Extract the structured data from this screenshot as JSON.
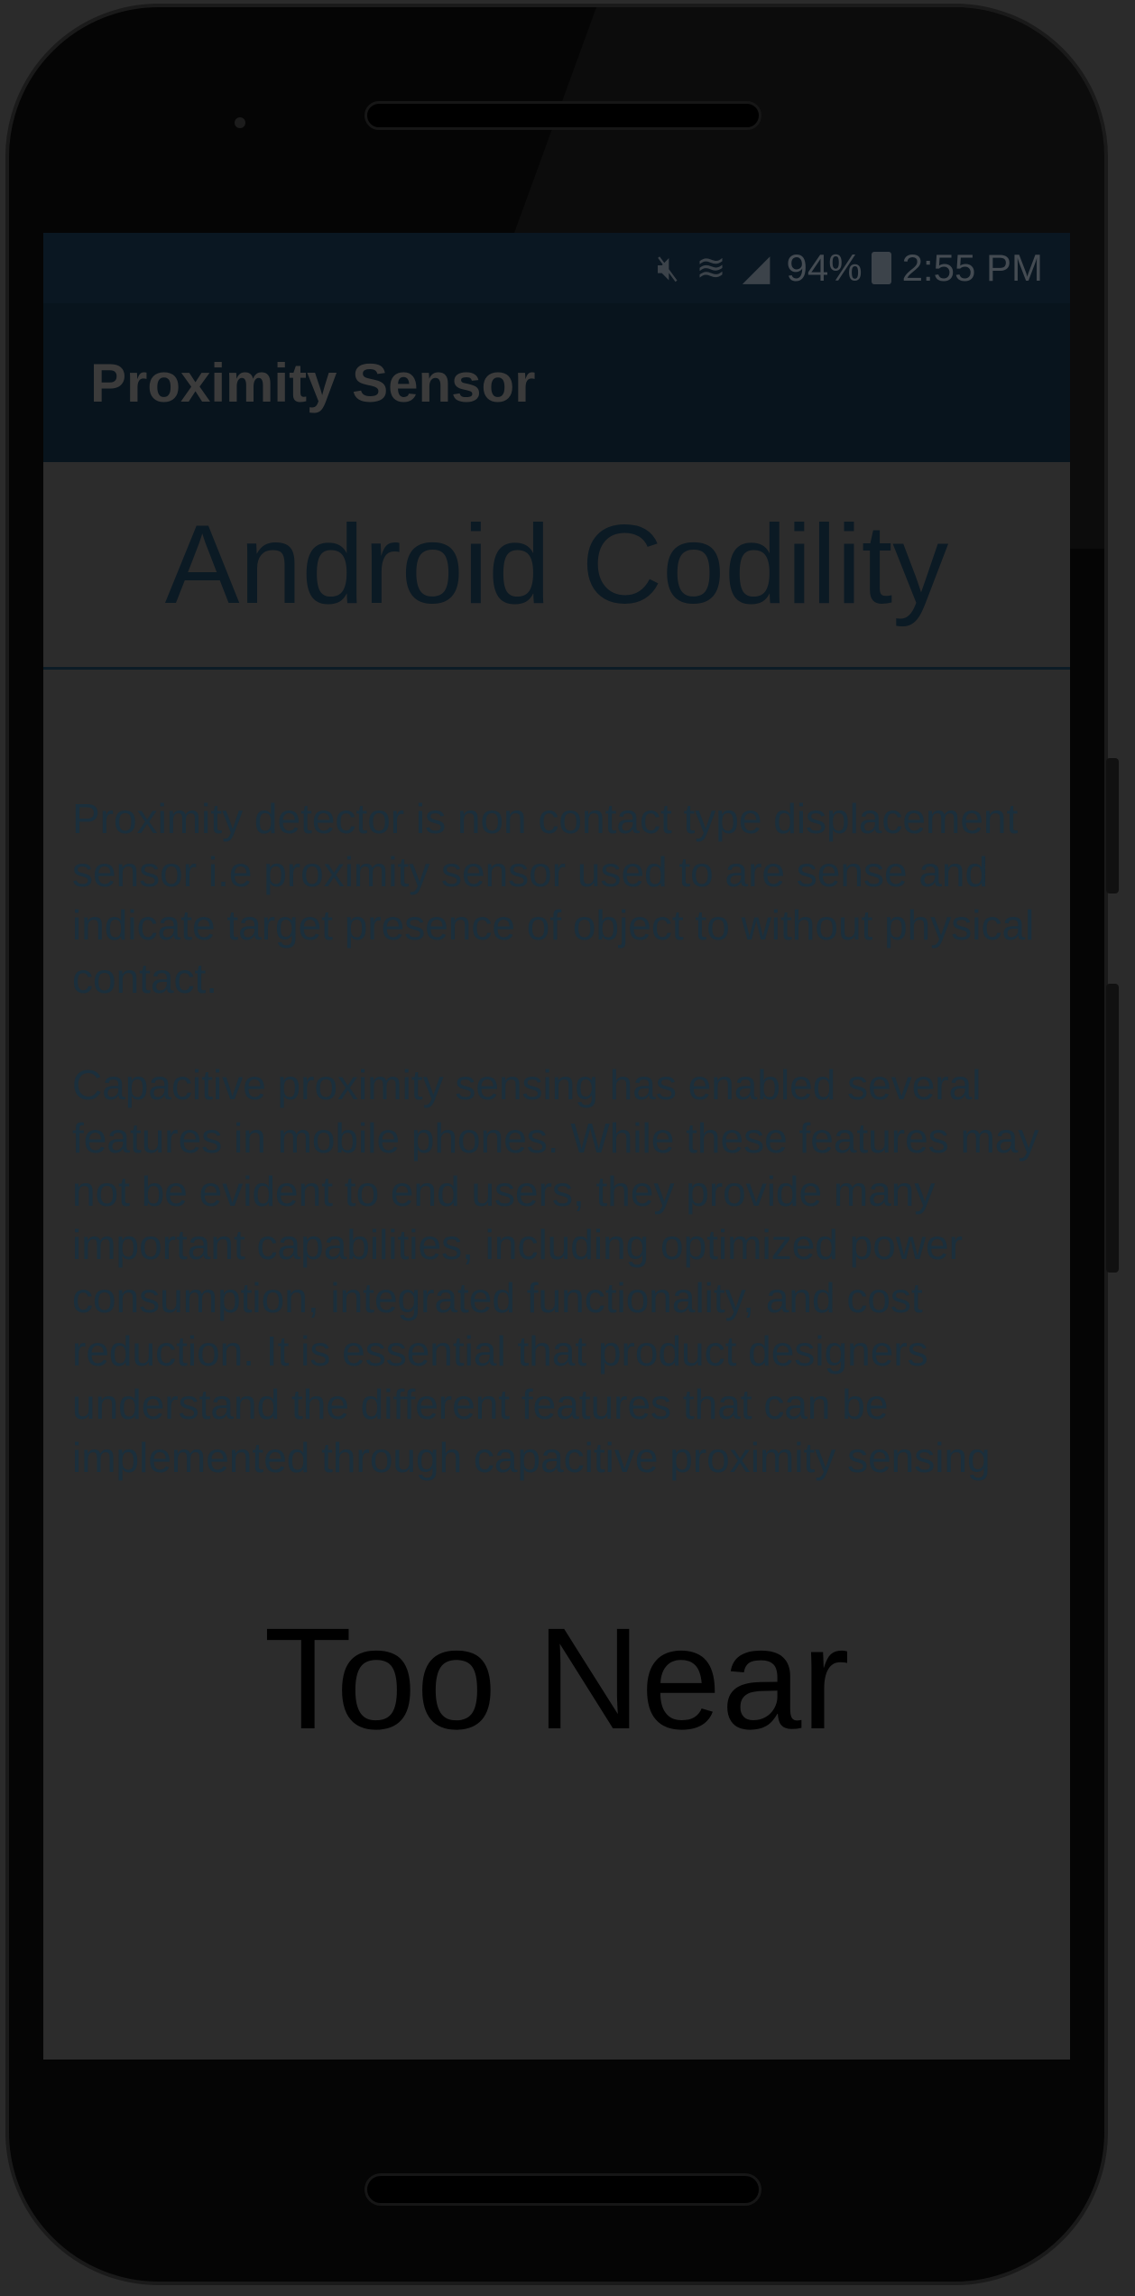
{
  "status_bar": {
    "mute_icon": "mute-icon",
    "wifi_icon": "wifi-icon",
    "signal_icon": "signal-icon",
    "battery_percent": "94%",
    "battery_icon": "battery-charging-icon",
    "time": "2:55 PM"
  },
  "app_bar": {
    "title": "Proximity Sensor"
  },
  "header": {
    "title": "Android Codility"
  },
  "content": {
    "paragraph1": "Proximity detector is non contact type displacement sensor i.e proximity sensor used to are sense and indicate target presence of object to without physical contact.",
    "paragraph2": "Capacitive proximity sensing has enabled several features in mobile phones. While these features may not be evident to end users, they provide many important capabilities, including optimized power consumption, integrated functionality, and cost reduction. It is essential that product designers understand the different features that can be implemented through capacitive proximity sensing"
  },
  "sensor": {
    "status": "Too Near"
  },
  "colors": {
    "status_bar": "#0a1722",
    "app_bar": "#08141d",
    "background": "#2c2c2c",
    "text": "#1b2f3c"
  }
}
